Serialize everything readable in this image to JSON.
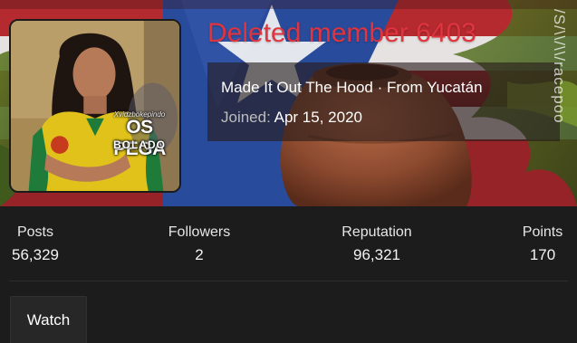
{
  "profile": {
    "username": "Deleted member 6403",
    "user_title": "Made It Out The Hood · From Yucatán",
    "joined_label": "Joined:",
    "joined_date": "Apr 15, 2020",
    "cover_watermark": "/S/\\\\/\\\\/racepoo",
    "avatar_watermark": {
      "small": "Xvidzbokepindo",
      "big": "OS PEGA",
      "sub": "BOLADO"
    }
  },
  "stats": [
    {
      "label": "Posts",
      "value": "56,329"
    },
    {
      "label": "Followers",
      "value": "2"
    },
    {
      "label": "Reputation",
      "value": "96,321"
    },
    {
      "label": "Points",
      "value": "170"
    }
  ],
  "actions": {
    "watch_label": "Watch"
  },
  "colors": {
    "username": "#e0343f",
    "background": "#1c1c1c",
    "button": "#272727"
  }
}
